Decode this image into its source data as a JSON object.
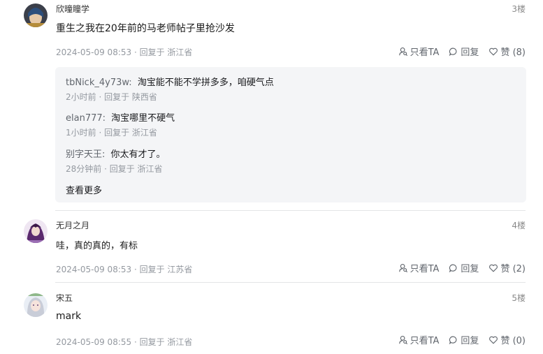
{
  "posts": [
    {
      "username": "欣曈瞳学",
      "floor": "3楼",
      "content": "重生之我在20年前的马老师帖子里抢沙发",
      "meta": "2024-05-09 08:53 · 回复于 浙江省",
      "only_ta": "只看TA",
      "reply": "回复",
      "like": "赞 (8)",
      "replies": [
        {
          "name": "tbNick_4y73w:",
          "text": "淘宝能不能不学拼多多，咱硬气点",
          "meta": "2小时前 · 回复于 陕西省"
        },
        {
          "name": "elan777:",
          "text": "淘宝哪里不硬气",
          "meta": "1小时前 · 回复于 浙江省"
        },
        {
          "name": "别字天王:",
          "text": "你太有才了。",
          "meta": "28分钟前 · 回复于 浙江省"
        }
      ],
      "more": "查看更多"
    },
    {
      "username": "无月之月",
      "floor": "4楼",
      "content": "哇，真的真的，有标",
      "meta": "2024-05-09 08:53 · 回复于 江苏省",
      "only_ta": "只看TA",
      "reply": "回复",
      "like": "赞 (2)"
    },
    {
      "username": "宋五",
      "floor": "5楼",
      "content": "mark",
      "meta": "2024-05-09 08:55 · 回复于 浙江省",
      "only_ta": "只看TA",
      "reply": "回复",
      "like": "赞 (0)"
    }
  ],
  "icons": {
    "only_ta": "user-filter-icon",
    "reply": "comment-icon",
    "like": "heart-icon"
  }
}
